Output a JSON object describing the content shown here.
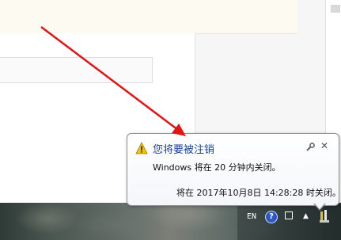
{
  "notification": {
    "title": "您将要被注销",
    "body": "Windows 将在 20 分钟内关闭。",
    "time": "将在 2017年10月8日 14:28:28 时关闭。",
    "close_glyph": "✕"
  },
  "tray": {
    "language": "EN",
    "help_glyph": "?",
    "arrow_glyph": "▲"
  },
  "colors": {
    "arrow": "#e31414",
    "title": "#1a3f9a",
    "warning": "#f2c200"
  }
}
